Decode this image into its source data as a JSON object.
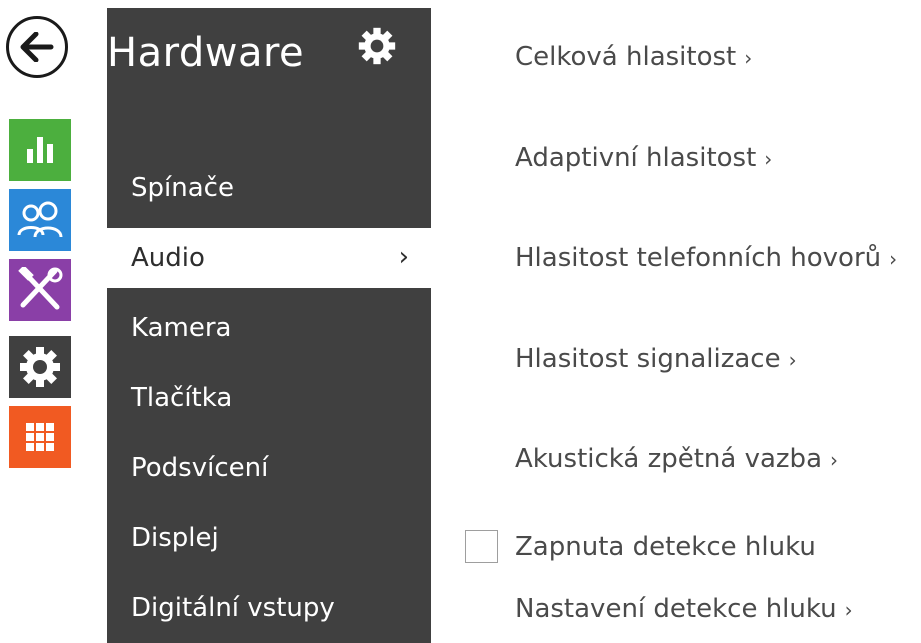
{
  "colors": {
    "panel": "#404040",
    "statusTile": "#4caf3e",
    "usersTile": "#2b88d8",
    "servicesTile": "#8a3fa7",
    "hardwareTile": "#404040",
    "systemTile": "#f15a22"
  },
  "rail": {
    "items": [
      {
        "name": "status",
        "icon": "bar-chart-icon"
      },
      {
        "name": "users",
        "icon": "users-icon"
      },
      {
        "name": "services",
        "icon": "tools-icon"
      },
      {
        "name": "hardware",
        "icon": "gear-icon"
      },
      {
        "name": "system",
        "icon": "grid-icon"
      }
    ]
  },
  "submenu": {
    "title": "Hardware",
    "items": [
      {
        "label": "Spínače"
      },
      {
        "label": "Audio",
        "chevron": "›"
      },
      {
        "label": "Kamera"
      },
      {
        "label": "Tlačítka"
      },
      {
        "label": "Podsvícení"
      },
      {
        "label": "Displej"
      },
      {
        "label": "Digitální vstupy"
      }
    ]
  },
  "audio": {
    "links": [
      "Celková hlasitost",
      "Adaptivní hlasitost",
      "Hlasitost telefonních hovorů",
      "Hlasitost signalizace",
      "Akustická zpětná vazba",
      "Nastavení detekce hluku"
    ],
    "chevron": "›",
    "noise_detection": {
      "label": "Zapnuta detekce hluku",
      "checked": false
    }
  }
}
